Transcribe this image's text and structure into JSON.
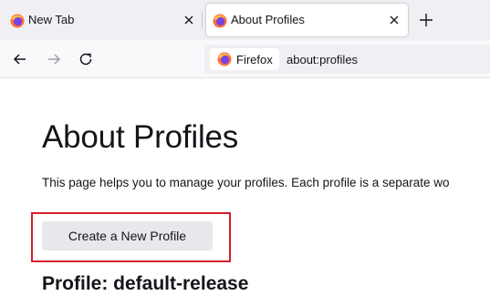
{
  "browser": {
    "tabs": [
      {
        "label": "New Tab",
        "active": false,
        "icon": "firefox-icon"
      },
      {
        "label": "About Profiles",
        "active": true,
        "icon": "firefox-icon"
      }
    ],
    "new_tab_icon": "plus-icon",
    "nav": {
      "back_icon": "back-arrow-icon",
      "forward_icon": "forward-arrow-icon",
      "reload_icon": "reload-icon"
    },
    "identity_label": "Firefox",
    "url": "about:profiles"
  },
  "page": {
    "title": "About Profiles",
    "intro": "This page helps you to manage your profiles. Each profile is a separate wo",
    "create_button": "Create a New Profile",
    "profile_heading": "Profile: default-release"
  },
  "colors": {
    "highlight": "#d4202c",
    "tabbar": "#f0f0f4",
    "button": "#e8e8ec"
  }
}
